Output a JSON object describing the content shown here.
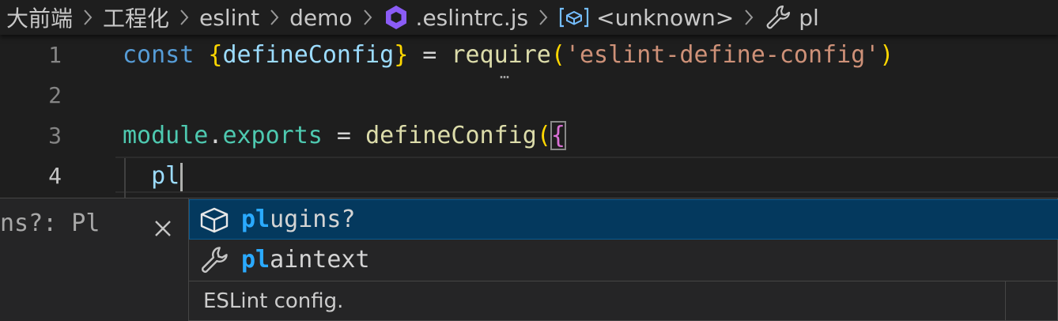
{
  "breadcrumb": {
    "items": [
      {
        "label": "大前端"
      },
      {
        "label": "工程化"
      },
      {
        "label": "eslint"
      },
      {
        "label": "demo"
      },
      {
        "label": ".eslintrc.js",
        "icon": "eslint-hex-icon"
      },
      {
        "label": "<unknown>",
        "icon": "module-icon"
      },
      {
        "label": "pl",
        "icon": "wrench-icon"
      }
    ]
  },
  "editor": {
    "line_numbers": [
      "1",
      "2",
      "3",
      "4"
    ],
    "line1": {
      "kw": "const",
      "open_brace": "{",
      "name": "defineConfig",
      "close_brace": "}",
      "eq": " = ",
      "call": "require",
      "open_paren": "(",
      "string": "'eslint-define-config'",
      "close_paren": ")"
    },
    "line3": {
      "ns": "module",
      "dot": ".",
      "prop": "exports",
      "eq": " = ",
      "call": "defineConfig",
      "open_paren": "(",
      "open_brace": "{"
    },
    "line4": {
      "indent": "  ",
      "typed": "pl"
    },
    "hint_dots": "…"
  },
  "detail": {
    "signature": "ns?: Pl"
  },
  "suggest": {
    "items": [
      {
        "match": "pl",
        "rest": "ugins?",
        "icon": "property-box-icon",
        "selected": true
      },
      {
        "match": "pl",
        "rest": "aintext",
        "icon": "wrench-icon",
        "selected": false
      }
    ],
    "doc": "ESLint config."
  },
  "colors": {
    "background": "#1e1e1e",
    "keyword": "#569cd6",
    "string": "#ce9178",
    "function": "#dcdcaa",
    "match": "#2aaaff",
    "selection": "#04395e",
    "eslint_icon": "#8b5cf6"
  }
}
